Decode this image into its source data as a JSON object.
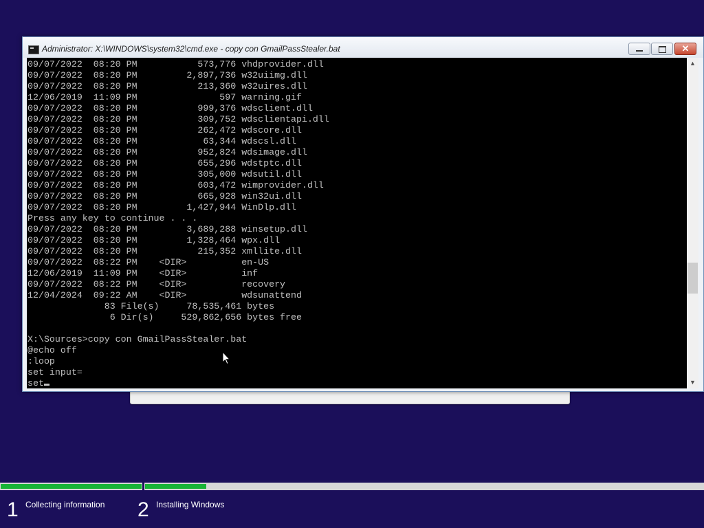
{
  "window": {
    "title": "Administrator: X:\\WINDOWS\\system32\\cmd.exe - copy  con GmailPassStealer.bat",
    "minimize_glyph": "",
    "maximize_glyph": "",
    "close_glyph": "✕"
  },
  "console": {
    "lines": [
      "09/07/2022  08:20 PM           573,776 vhdprovider.dll",
      "09/07/2022  08:20 PM         2,897,736 w32uiimg.dll",
      "09/07/2022  08:20 PM           213,360 w32uires.dll",
      "12/06/2019  11:09 PM               597 warning.gif",
      "09/07/2022  08:20 PM           999,376 wdsclient.dll",
      "09/07/2022  08:20 PM           309,752 wdsclientapi.dll",
      "09/07/2022  08:20 PM           262,472 wdscore.dll",
      "09/07/2022  08:20 PM            63,344 wdscsl.dll",
      "09/07/2022  08:20 PM           952,824 wdsimage.dll",
      "09/07/2022  08:20 PM           655,296 wdstptc.dll",
      "09/07/2022  08:20 PM           305,000 wdsutil.dll",
      "09/07/2022  08:20 PM           603,472 wimprovider.dll",
      "09/07/2022  08:20 PM           665,928 win32ui.dll",
      "09/07/2022  08:20 PM         1,427,944 WinDlp.dll",
      "Press any key to continue . . .",
      "09/07/2022  08:20 PM         3,689,288 winsetup.dll",
      "09/07/2022  08:20 PM         1,328,464 wpx.dll",
      "09/07/2022  08:20 PM           215,352 xmllite.dll",
      "09/07/2022  08:22 PM    <DIR>          en-US",
      "12/06/2019  11:09 PM    <DIR>          inf",
      "09/07/2022  08:22 PM    <DIR>          recovery",
      "12/04/2024  09:22 AM    <DIR>          wdsunattend",
      "              83 File(s)     78,535,461 bytes",
      "               6 Dir(s)     529,862,656 bytes free",
      "",
      "X:\\Sources>copy con GmailPassStealer.bat",
      "@echo off",
      ":loop",
      "set input="
    ],
    "current_input": "set"
  },
  "scrollbar": {
    "up_arrow": "▲",
    "down_arrow": "▼"
  },
  "setup": {
    "progress": {
      "step1_fraction": 1.0,
      "step2_fraction": 0.11
    },
    "steps": [
      {
        "number": "1",
        "label": "Collecting information"
      },
      {
        "number": "2",
        "label": "Installing Windows"
      }
    ]
  },
  "colors": {
    "background": "#1b0f5a",
    "progress_fill": "#18b336",
    "console_text": "#c0c0c0"
  }
}
